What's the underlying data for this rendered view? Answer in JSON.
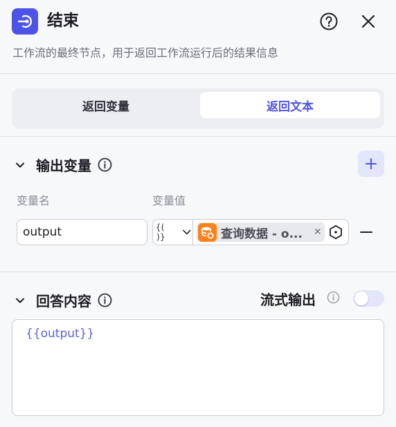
{
  "header": {
    "title": "结束",
    "description": "工作流的最终节点，用于返回工作流运行后的结果信息",
    "icon": "end-node-icon",
    "accent_color": "#4d53e8"
  },
  "mode_tabs": {
    "tabs": [
      {
        "label": "返回变量",
        "selected": false
      },
      {
        "label": "返回文本",
        "selected": true
      }
    ]
  },
  "output_section": {
    "title": "输出变量",
    "columns": {
      "name": "变量名",
      "value": "变量值"
    },
    "rows": [
      {
        "name": "output",
        "type_icon": "{( )}",
        "reference": "查询数据 - o...",
        "reference_icon": "database-icon",
        "reference_icon_color": "#ff811a"
      }
    ]
  },
  "answer_section": {
    "title": "回答内容",
    "stream_label": "流式输出",
    "stream_enabled": false,
    "content": "{{output}}"
  }
}
